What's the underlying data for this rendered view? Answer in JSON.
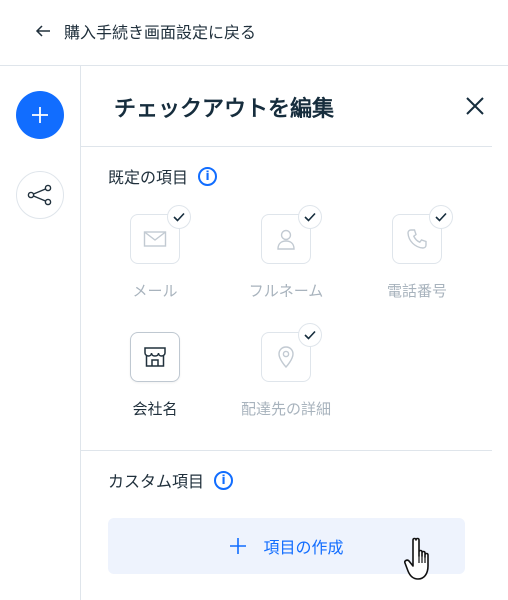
{
  "topbar": {
    "back_label": "購入手続き画面設定に戻る"
  },
  "rail": {
    "add_icon": "plus-icon",
    "flow_icon": "branch-icon"
  },
  "panel": {
    "title": "チェックアウトを編集",
    "default_section": {
      "title": "既定の項目",
      "fields": [
        {
          "label": "メール",
          "icon": "mail-icon",
          "checked": true,
          "enabled": false
        },
        {
          "label": "フルネーム",
          "icon": "person-icon",
          "checked": true,
          "enabled": false
        },
        {
          "label": "電話番号",
          "icon": "phone-icon",
          "checked": true,
          "enabled": false
        },
        {
          "label": "会社名",
          "icon": "store-icon",
          "checked": false,
          "enabled": true
        },
        {
          "label": "配達先の詳細",
          "icon": "location-pin-icon",
          "checked": true,
          "enabled": false
        }
      ]
    },
    "custom_section": {
      "title": "カスタム項目",
      "create_label": "項目の作成"
    }
  },
  "colors": {
    "accent": "#116dff",
    "button_bg": "#eef3fd",
    "disabled_text": "#a8b3bd",
    "border": "#dfe5eb"
  }
}
